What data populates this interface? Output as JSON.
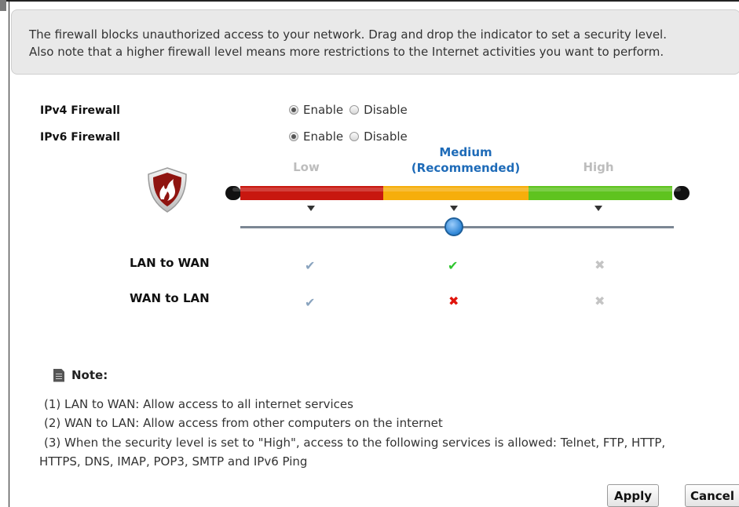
{
  "description": {
    "line1": "The firewall blocks unauthorized access to your network. Drag and drop the indicator to set a security level.",
    "line2": "Also note that a higher firewall level means more restrictions to the Internet activities you want to perform."
  },
  "settings": {
    "ipv4": {
      "label": "IPv4 Firewall",
      "enable": "Enable",
      "disable": "Disable",
      "selected": "Enable"
    },
    "ipv6": {
      "label": "IPv6 Firewall",
      "enable": "Enable",
      "disable": "Disable",
      "selected": "Enable"
    }
  },
  "security_level": {
    "low": "Low",
    "medium_line1": "Medium",
    "medium_line2": "(Recommended)",
    "high": "High",
    "selected": "Medium",
    "colors": {
      "low": "#c8170f",
      "medium": "#f6ae0b",
      "high": "#5fc31f",
      "active_label": "#1e6bb8"
    }
  },
  "matrix": {
    "rows": [
      {
        "label": "LAN to WAN",
        "low": "allowed",
        "medium": "allowed",
        "high": "blocked"
      },
      {
        "label": "WAN to LAN",
        "low": "allowed",
        "medium": "blocked",
        "high": "blocked"
      }
    ],
    "icons": {
      "allowed": "✔",
      "blocked": "✖"
    }
  },
  "note": {
    "title": "Note:",
    "line1": "(1) LAN to WAN: Allow access to all internet services",
    "line2": "(2) WAN to LAN: Allow access from other computers on the internet",
    "line3a": "(3) When the security level is set to \"High\", access to the following services is allowed: Telnet, FTP, HTTP,",
    "line3b": "HTTPS, DNS, IMAP, POP3, SMTP and IPv6 Ping"
  },
  "buttons": {
    "apply": "Apply",
    "cancel": "Cancel"
  }
}
